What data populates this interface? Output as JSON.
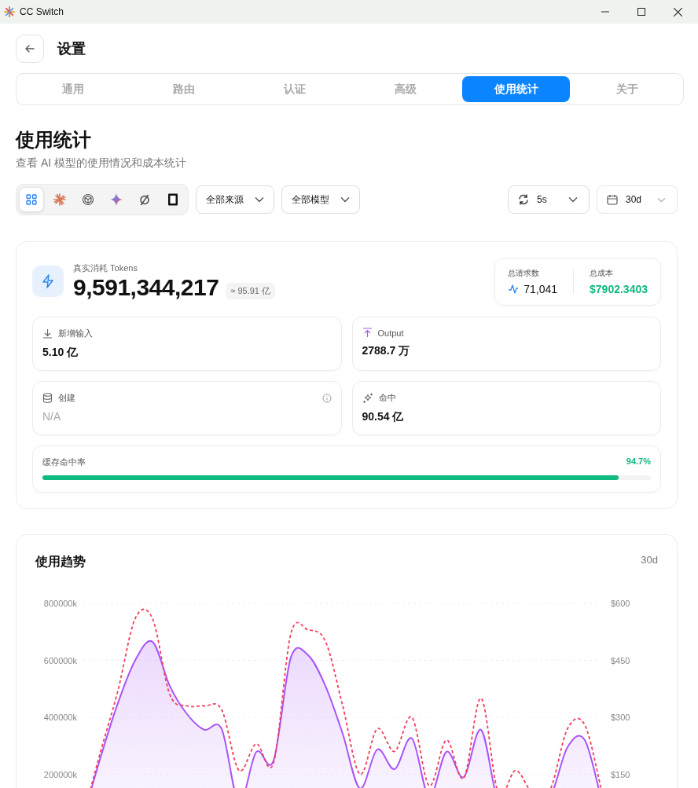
{
  "window": {
    "title": "CC Switch"
  },
  "header": {
    "title": "设置"
  },
  "tabs": [
    {
      "label": "通用",
      "selected": false
    },
    {
      "label": "路由",
      "selected": false
    },
    {
      "label": "认证",
      "selected": false
    },
    {
      "label": "高级",
      "selected": false
    },
    {
      "label": "使用统计",
      "selected": true
    },
    {
      "label": "关于",
      "selected": false
    }
  ],
  "page": {
    "title": "使用统计",
    "subtitle": "查看 AI 模型的使用情况和成本统计"
  },
  "filters": {
    "apps": [
      {
        "kind": "all",
        "selected": true
      },
      {
        "kind": "asterisk",
        "selected": false
      },
      {
        "kind": "knot",
        "selected": false
      },
      {
        "kind": "sparkle",
        "selected": false
      },
      {
        "kind": "slashed",
        "selected": false
      },
      {
        "kind": "rectangle",
        "selected": false
      }
    ],
    "source": "全部来源",
    "model": "全部模型",
    "refresh": "5s",
    "range": "30d"
  },
  "summary": {
    "label": "真实消耗 Tokens",
    "total": "9,591,344,217",
    "approx": "≈ 95.91 亿",
    "requests": {
      "label": "总请求数",
      "value": "71,041"
    },
    "cost": {
      "label": "总成本",
      "value": "$7902.3403"
    },
    "metrics": [
      {
        "kind": "input",
        "label": "新增输入",
        "value": "5.10 亿",
        "muted": false
      },
      {
        "kind": "output",
        "label": "Output",
        "value": "2788.7 万",
        "muted": false
      },
      {
        "kind": "create",
        "label": "创建",
        "value": "N/A",
        "muted": true
      },
      {
        "kind": "hit",
        "label": "命中",
        "value": "90.54 亿",
        "muted": false
      }
    ],
    "cache": {
      "label": "缓存命中率",
      "reading": "94.7%",
      "level": 0.947
    }
  },
  "trend": {
    "title": "使用趋势",
    "range": "30d",
    "chart_data": {
      "type": "area",
      "ylim": [
        0,
        800000
      ],
      "yticks": [
        {
          "value": 200000,
          "label": "200000k"
        },
        {
          "value": 400000,
          "label": "400000k"
        },
        {
          "value": 600000,
          "label": "600000k"
        },
        {
          "value": 800000,
          "label": "800000k"
        }
      ],
      "y2lim": [
        0,
        600
      ],
      "y2ticks": [
        {
          "value": 150,
          "label": "$150"
        },
        {
          "value": 300,
          "label": "$300"
        },
        {
          "value": 450,
          "label": "$450"
        },
        {
          "value": 600,
          "label": "$600"
        }
      ],
      "grid": true,
      "series": [
        {
          "type": "area",
          "color": "#a855f7",
          "values": [
            50000,
            260000,
            450000,
            600000,
            665000,
            510000,
            411000,
            356000,
            359000,
            100000,
            278000,
            248000,
            610000,
            618000,
            510000,
            342000,
            150000,
            287000,
            218000,
            326000,
            120000,
            279000,
            190000,
            356000,
            100000,
            100000,
            100000,
            120000,
            295000,
            320000,
            100000
          ]
        },
        {
          "type": "line",
          "color": "#f43f5e",
          "axis": "y2",
          "line_style": "dashed",
          "values": [
            40,
            210,
            370,
            560,
            560,
            360,
            330,
            330,
            320,
            160,
            230,
            180,
            520,
            530,
            500,
            330,
            150,
            270,
            210,
            300,
            120,
            240,
            140,
            350,
            100,
            160,
            100,
            110,
            270,
            280,
            100
          ]
        }
      ]
    }
  }
}
